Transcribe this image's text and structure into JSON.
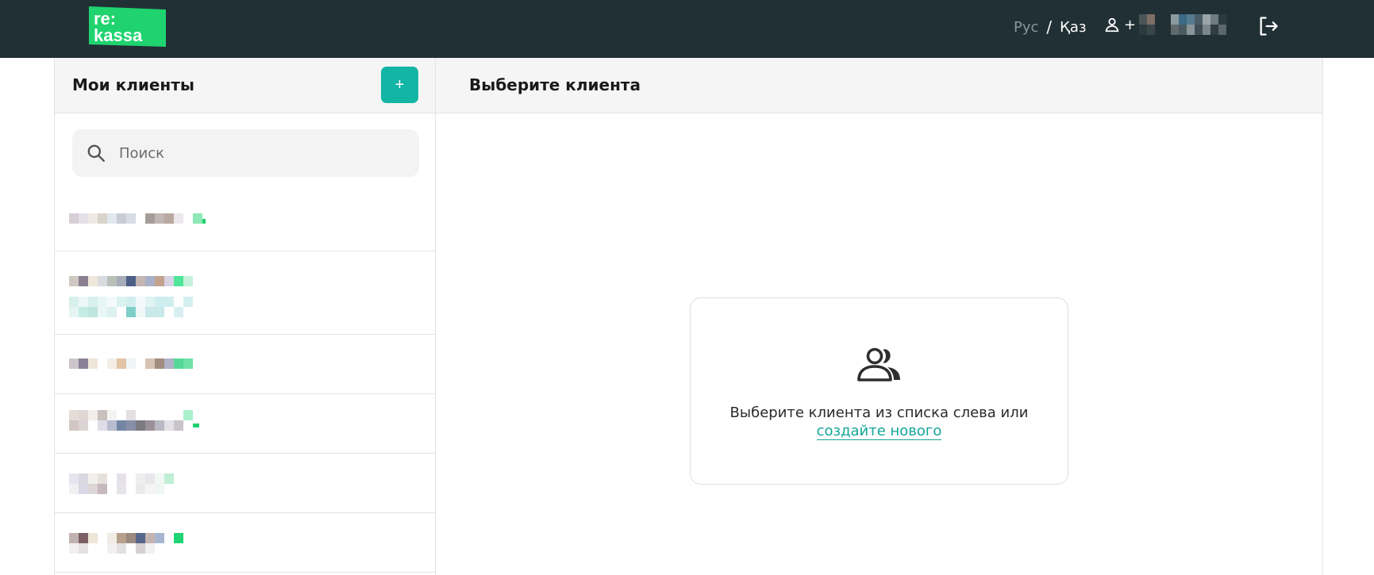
{
  "header": {
    "logo_text_top": "re:",
    "logo_text_bottom": "kassa",
    "lang_ru": "Рус",
    "lang_separator": "/",
    "lang_kz": "Қаз",
    "user_plus": "+",
    "icons": {
      "user": "user-icon",
      "logout": "logout-icon"
    }
  },
  "left_panel": {
    "title": "Мои клиенты",
    "add_label": "+",
    "search_placeholder": "Поиск"
  },
  "right_panel": {
    "title": "Выберите клиента",
    "empty_text": "Выберите клиента из списка слева или",
    "empty_link": "создайте нового"
  },
  "colors": {
    "header_bg": "#213035",
    "accent": "#13b5a4",
    "logo_green": "#1fd36e"
  }
}
